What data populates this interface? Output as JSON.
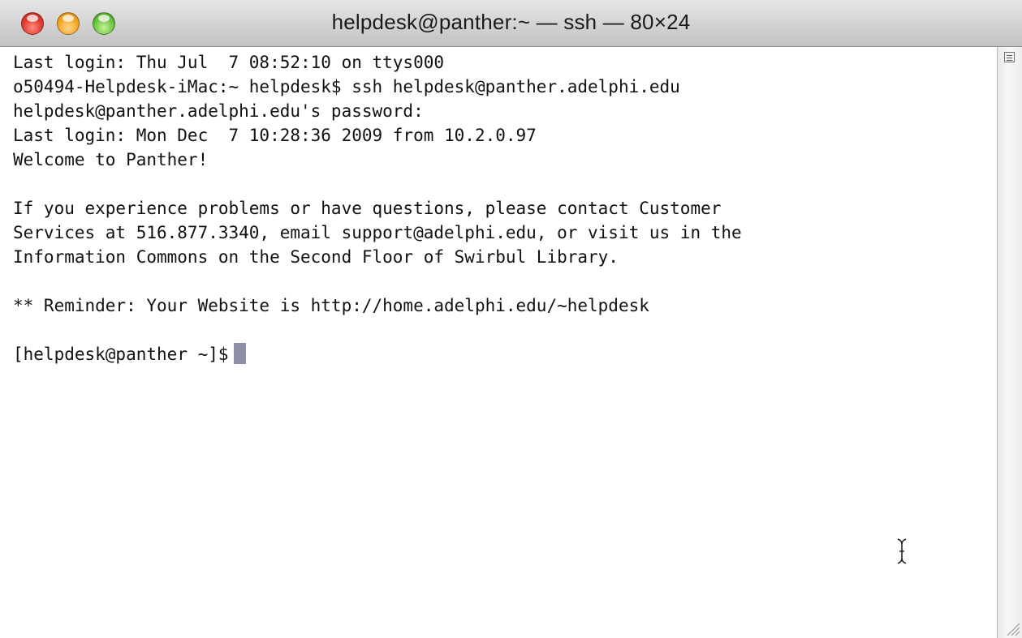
{
  "window": {
    "title": "helpdesk@panther:~ — ssh — 80×24"
  },
  "terminal": {
    "lines": [
      "Last login: Thu Jul  7 08:52:10 on ttys000",
      "o50494-Helpdesk-iMac:~ helpdesk$ ssh helpdesk@panther.adelphi.edu",
      "helpdesk@panther.adelphi.edu's password:",
      "Last login: Mon Dec  7 10:28:36 2009 from 10.2.0.97",
      "Welcome to Panther!",
      "",
      "If you experience problems or have questions, please contact Customer",
      "Services at 516.877.3340, email support@adelphi.edu, or visit us in the",
      "Information Commons on the Second Floor of Swirbul Library.",
      "",
      "** Reminder: Your Website is http://home.adelphi.edu/~helpdesk",
      ""
    ],
    "prompt": "[helpdesk@panther ~]$"
  },
  "icons": {
    "close": "close-button",
    "minimize": "minimize-button",
    "zoom": "zoom-button",
    "scroll_menu": "scrollbar-menu-icon",
    "resize": "resize-grip-icon",
    "cursor": "ibeam-cursor-icon"
  },
  "colors": {
    "close": "#e0392d",
    "minimize": "#f4a623",
    "zoom": "#6bc33f",
    "cursor_block": "#8e8ea6"
  }
}
